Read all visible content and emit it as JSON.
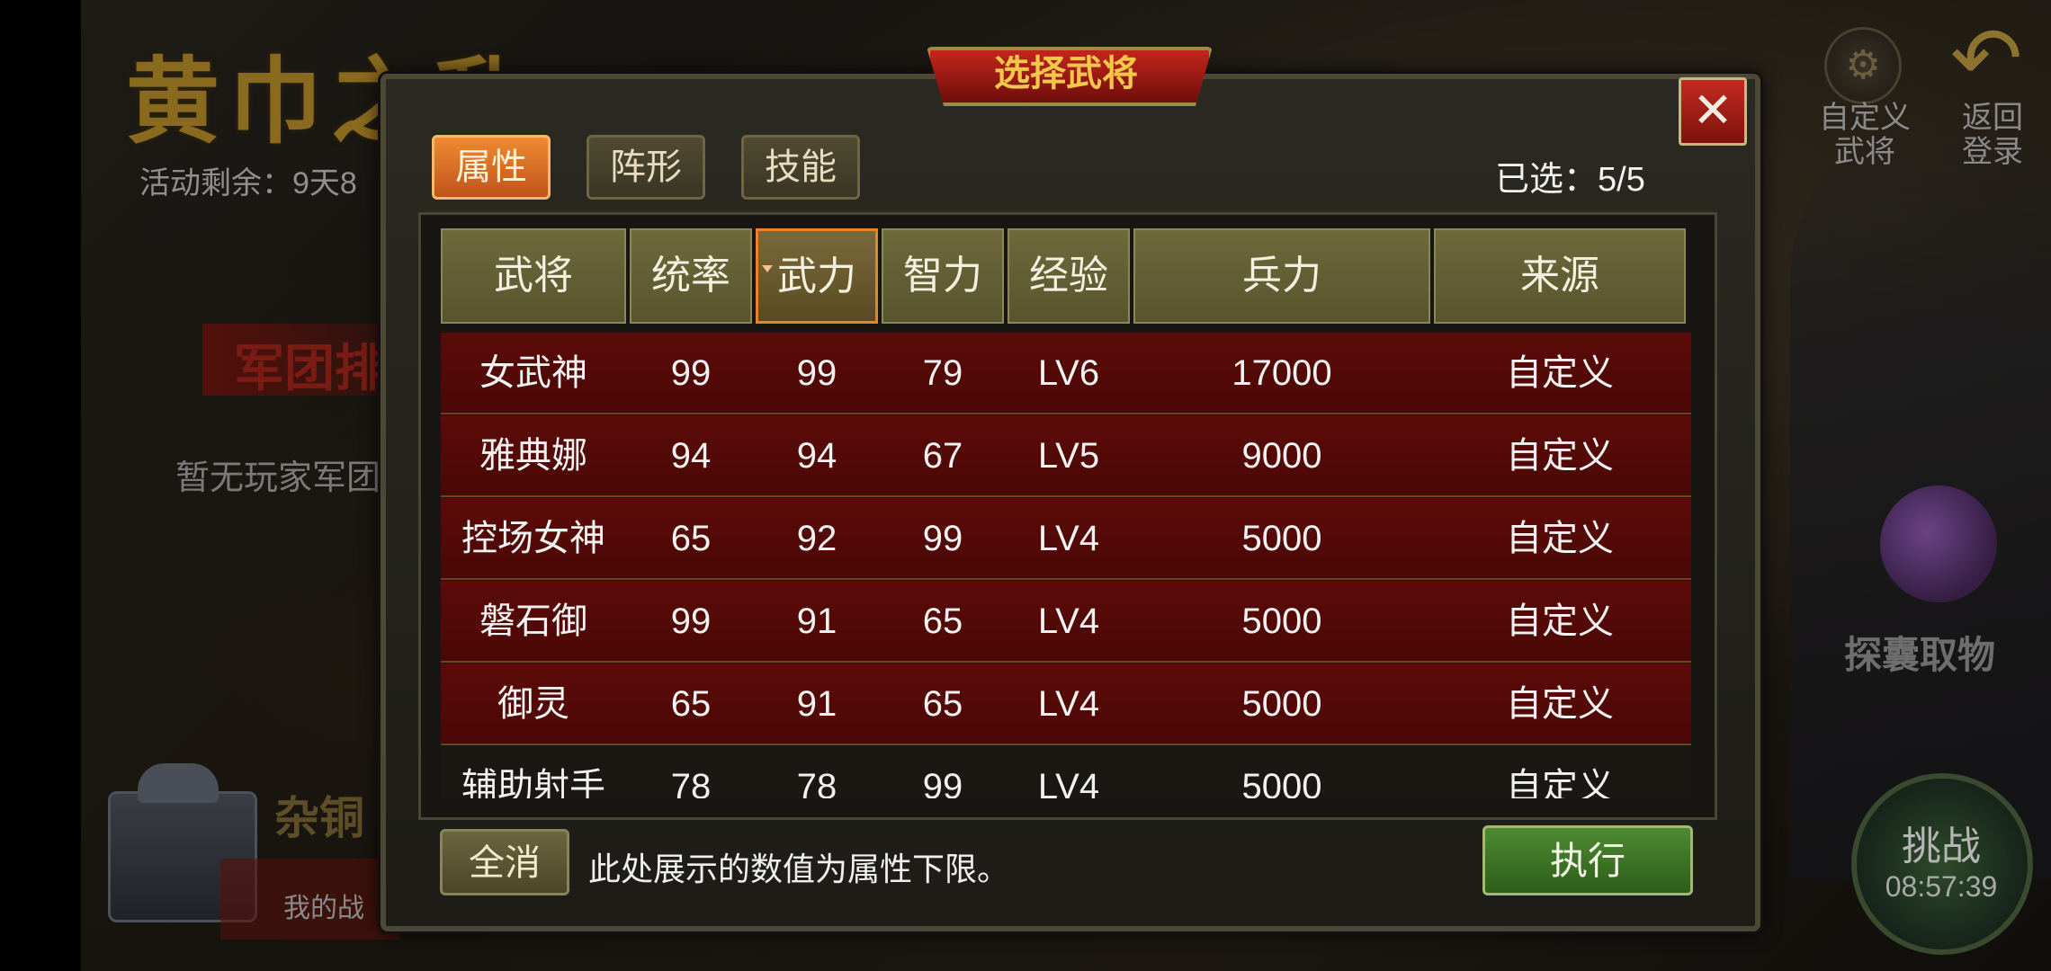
{
  "background": {
    "event_title": "黄巾之乱",
    "event_remaining": "活动剩余：9天8",
    "legion_rank_title": "军团排",
    "no_legion_text": "暂无玩家军团",
    "misc_title": "杂铜",
    "my_battle_text": "我的战",
    "custom_general_label": "自定义武将",
    "back_label": "返回登录",
    "bag_label": "探囊取物",
    "challenge_label": "挑战",
    "challenge_timer": "08:57:39"
  },
  "dialog": {
    "title": "选择武将",
    "close_symbol": "✕",
    "tabs": [
      {
        "label": "属性",
        "active": true
      },
      {
        "label": "阵形",
        "active": false
      },
      {
        "label": "技能",
        "active": false
      }
    ],
    "selected_count": "已选：5/5",
    "columns": [
      "武将",
      "统率",
      "武力",
      "智力",
      "经验",
      "兵力",
      "来源"
    ],
    "sorted_column": "武力",
    "rows": [
      {
        "name": "女武神",
        "command": "99",
        "force": "99",
        "intellect": "79",
        "level": "LV6",
        "troops": "17000",
        "source": "自定义",
        "selected": true
      },
      {
        "name": "雅典娜",
        "command": "94",
        "force": "94",
        "intellect": "67",
        "level": "LV5",
        "troops": "9000",
        "source": "自定义",
        "selected": true
      },
      {
        "name": "控场女神",
        "command": "65",
        "force": "92",
        "intellect": "99",
        "level": "LV4",
        "troops": "5000",
        "source": "自定义",
        "selected": true
      },
      {
        "name": "磐石御",
        "command": "99",
        "force": "91",
        "intellect": "65",
        "level": "LV4",
        "troops": "5000",
        "source": "自定义",
        "selected": true
      },
      {
        "name": "御灵",
        "command": "65",
        "force": "91",
        "intellect": "65",
        "level": "LV4",
        "troops": "5000",
        "source": "自定义",
        "selected": true
      },
      {
        "name": "辅助射手",
        "command": "78",
        "force": "78",
        "intellect": "99",
        "level": "LV4",
        "troops": "5000",
        "source": "自定义",
        "selected": false
      }
    ],
    "cancel_all_label": "全消",
    "hint_text": "此处展示的数值为属性下限。",
    "execute_label": "执行"
  },
  "colors": {
    "selected_row": "#5c0b08",
    "active_tab": "#ef8a32",
    "execute_button": "#4e8a32",
    "title_text": "#f3c84a"
  }
}
